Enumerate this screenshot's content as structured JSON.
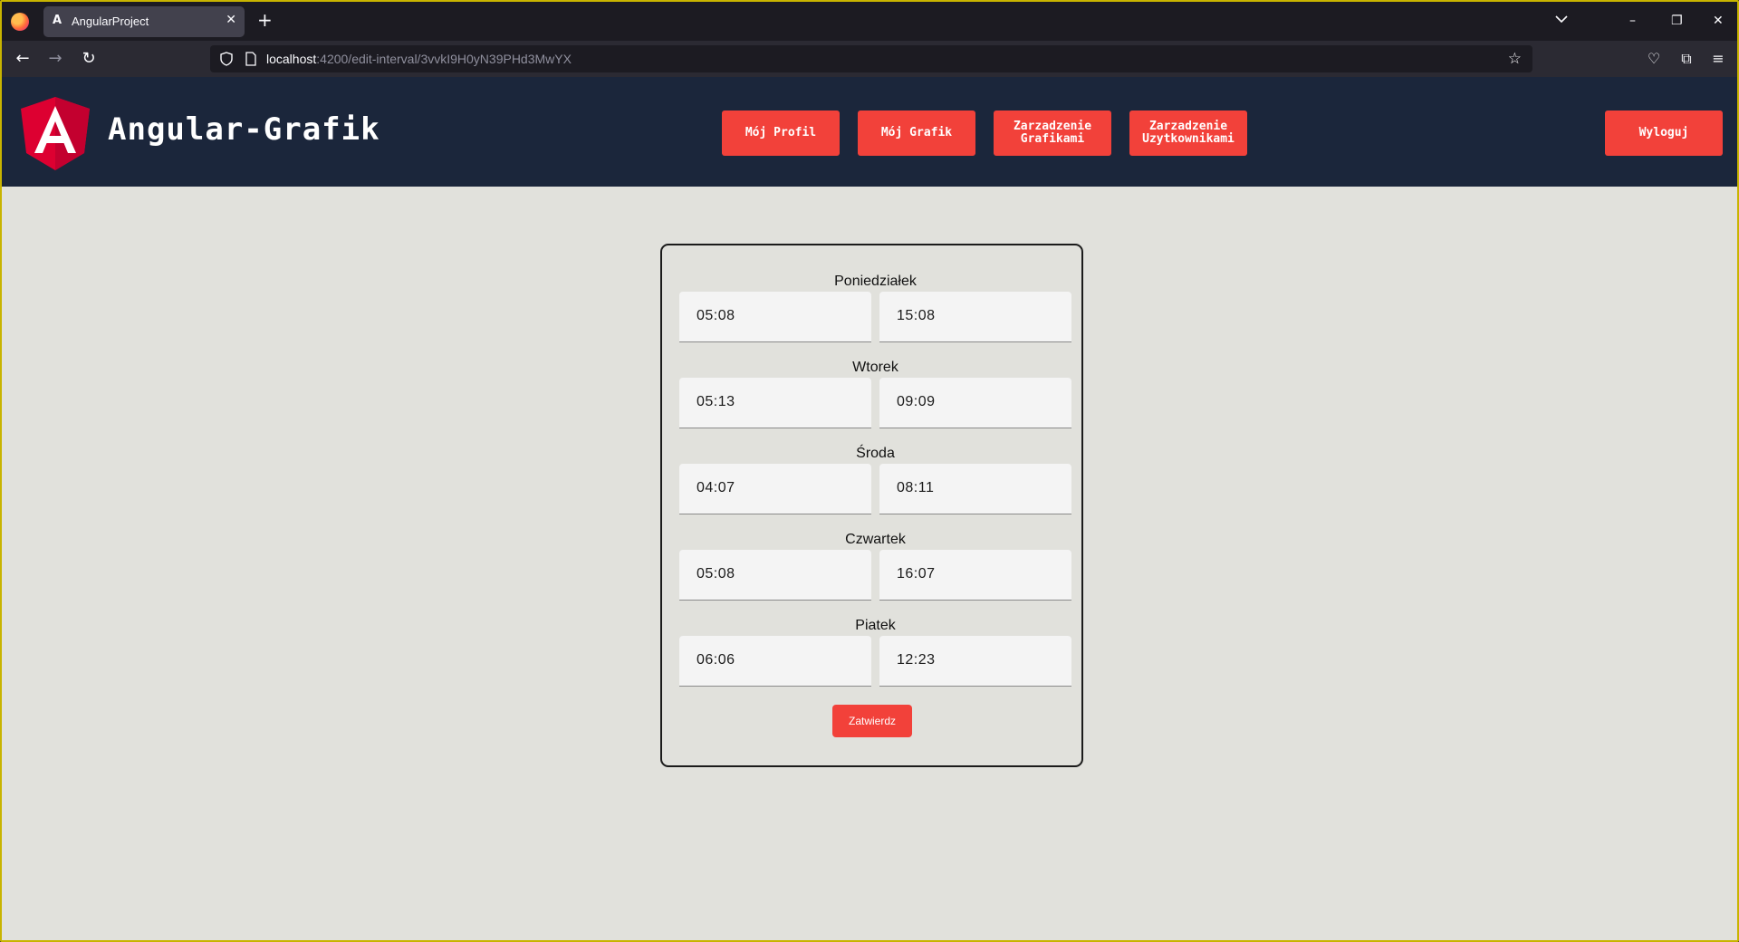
{
  "browser": {
    "tab_title": "AngularProject",
    "tab_favicon": "A",
    "url_host": "localhost",
    "url_path": ":4200/edit-interval/3vvkI9H0yN39PHd3MwYX"
  },
  "app": {
    "brand": "Angular-Grafik",
    "nav": {
      "profile": "Mój Profil",
      "schedule": "Mój Grafik",
      "manage_schedules": "Zarzadzenie\nGrafikami",
      "manage_users": "Zarzadzenie\nUzytkownikami",
      "logout": "Wyloguj"
    }
  },
  "form": {
    "days": [
      {
        "label": "Poniedziałek",
        "start": "05:08",
        "end": "15:08"
      },
      {
        "label": "Wtorek",
        "start": "05:13",
        "end": "09:09"
      },
      {
        "label": "Środa",
        "start": "04:07",
        "end": "08:11"
      },
      {
        "label": "Czwartek",
        "start": "05:08",
        "end": "16:07"
      },
      {
        "label": "Piatek",
        "start": "06:06",
        "end": "12:23"
      }
    ],
    "submit_label": "Zatwierdz"
  },
  "colors": {
    "accent": "#f2413a",
    "header_bg": "#1b263b",
    "page_bg": "#e1e1dc"
  }
}
